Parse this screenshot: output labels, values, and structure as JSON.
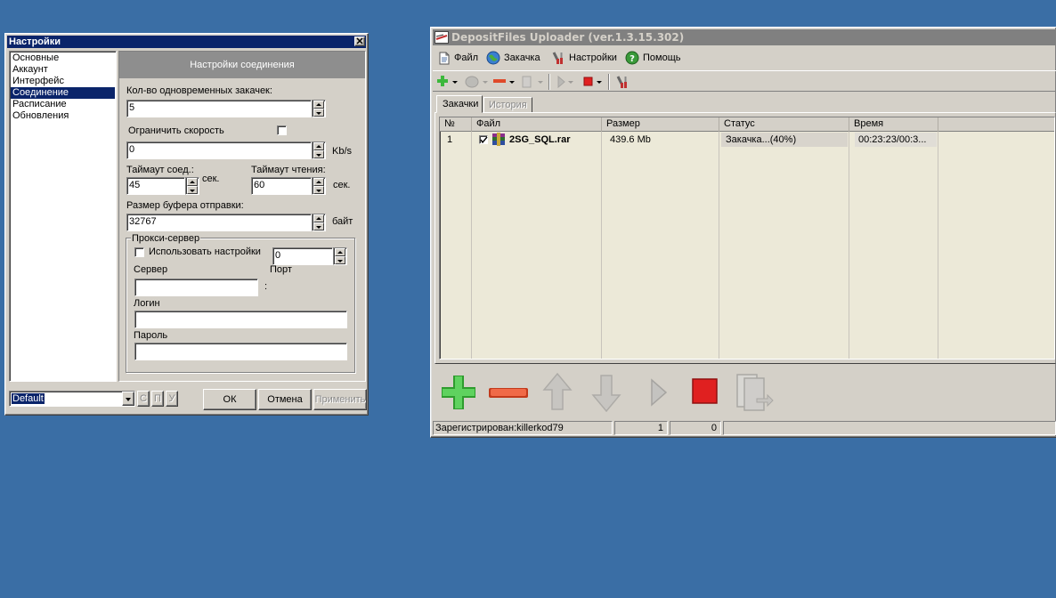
{
  "settings_dialog": {
    "title": "Настройки",
    "nav_items": [
      "Основные",
      "Аккаунт",
      "Интерфейс",
      "Соединение",
      "Расписание",
      "Обновления"
    ],
    "selected_nav_index": 3,
    "panel_header": "Настройки соединения",
    "concurrent_label": "Кол-во одновременных закачек:",
    "concurrent_value": "5",
    "limit_speed_label": "Ограничить скорость",
    "limit_speed_checked": false,
    "speed_value": "0",
    "speed_unit": "Kb/s",
    "conn_timeout_label": "Таймаут соед.:",
    "conn_timeout_value": "45",
    "conn_timeout_unit": "сек.",
    "read_timeout_label": "Таймаут чтения:",
    "read_timeout_value": "60",
    "read_timeout_unit": "сек.",
    "buffer_label": "Размер буфера отправки:",
    "buffer_value": "32767",
    "buffer_unit": "байт",
    "proxy_group_label": "Прокси-сервер",
    "proxy_use_label": "Использовать настройки",
    "proxy_use_checked": false,
    "proxy_type_value": "0",
    "server_label": "Сервер",
    "port_label": "Порт",
    "port_separator": ":",
    "server_value": "",
    "login_label": "Логин",
    "login_value": "",
    "password_label": "Пароль",
    "password_value": "",
    "profile_value": "Default",
    "profile_btn_c": "С",
    "profile_btn_p": "П",
    "profile_btn_u": "У",
    "ok_label": "ОК",
    "cancel_label": "Отмена",
    "apply_label": "Применить"
  },
  "uploader_window": {
    "title": "DepositFiles Uploader (ver.1.3.15.302)",
    "menu": [
      {
        "label": "Файл",
        "icon": "file-icon"
      },
      {
        "label": "Закачка",
        "icon": "globe-icon"
      },
      {
        "label": "Настройки",
        "icon": "tools-icon"
      },
      {
        "label": "Помощь",
        "icon": "help-icon"
      }
    ],
    "tabs": [
      {
        "label": "Закачки",
        "active": true
      },
      {
        "label": "История",
        "active": false
      }
    ],
    "columns": [
      "№",
      "Файл",
      "Размер",
      "Статус",
      "Время"
    ],
    "rows": [
      {
        "num": "1",
        "checked": true,
        "file": "2SG_SQL.rar",
        "size": "439.6 Mb",
        "status": "Закачка...(40%)",
        "time": "00:23:23/00:3..."
      }
    ],
    "status_bar": {
      "registered": "Зарегистрирован:killerkod79",
      "count1": "1",
      "count2": "0"
    },
    "colors": {
      "add_green": "#3cb83c",
      "remove_red": "#e04a2a",
      "stop_red": "#e02020"
    }
  }
}
